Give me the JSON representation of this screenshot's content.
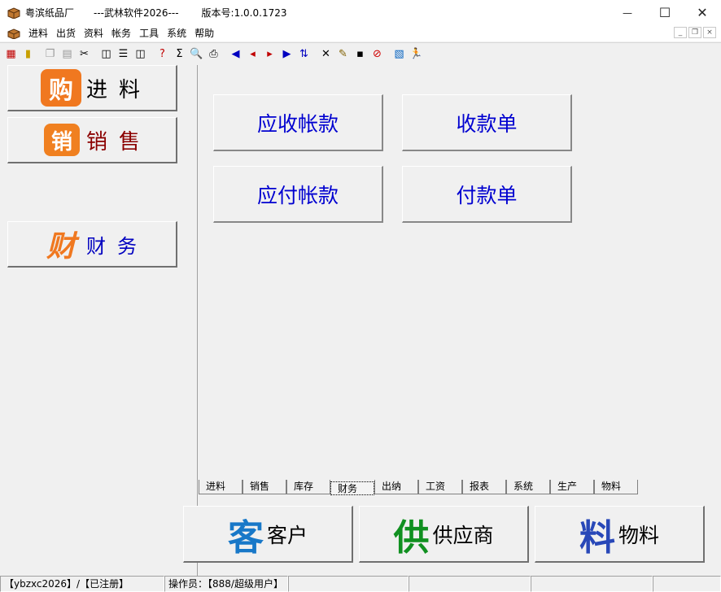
{
  "titlebar": {
    "app_name": "粤滨纸品厂",
    "product": "---武林软件2026---",
    "version": "版本号:1.0.0.1723",
    "minimize_glyph": "—",
    "maximize_glyph": "☐",
    "close_glyph": "✕"
  },
  "menu": {
    "items": [
      "进料",
      "出货",
      "资料",
      "帐务",
      "工具",
      "系统",
      "帮助"
    ],
    "mdi_minimize": "_",
    "mdi_restore": "❐",
    "mdi_close": "×"
  },
  "toolbar": {
    "buttons": [
      {
        "name": "calendar-icon",
        "glyph": "▦",
        "color": "#c00000"
      },
      {
        "name": "exit-door-icon",
        "glyph": "▮",
        "color": "#c8a000"
      },
      {
        "name": "copy-icon",
        "glyph": "❐",
        "color": "#999999"
      },
      {
        "name": "paste-icon",
        "glyph": "▤",
        "color": "#999999"
      },
      {
        "name": "cut-icon",
        "glyph": "✂",
        "color": "#000000"
      },
      {
        "name": "cascade-icon",
        "glyph": "◫",
        "color": "#000000"
      },
      {
        "name": "tile-horizontal-icon",
        "glyph": "☰",
        "color": "#000000"
      },
      {
        "name": "tile-vertical-icon",
        "glyph": "◫",
        "color": "#000000"
      },
      {
        "name": "find-icon",
        "glyph": "?",
        "color": "#c00000"
      },
      {
        "name": "sum-icon",
        "glyph": "Σ",
        "color": "#000000"
      },
      {
        "name": "preview-icon",
        "glyph": "🔍",
        "color": "#000000"
      },
      {
        "name": "print-icon",
        "glyph": "⎙",
        "color": "#000000"
      },
      {
        "name": "first-record-icon",
        "glyph": "◀",
        "color": "#0000c0"
      },
      {
        "name": "prev-record-icon",
        "glyph": "◂",
        "color": "#c00000"
      },
      {
        "name": "next-record-icon",
        "glyph": "▸",
        "color": "#c00000"
      },
      {
        "name": "last-record-icon",
        "glyph": "▶",
        "color": "#0000c0"
      },
      {
        "name": "insert-icon",
        "glyph": "⇅",
        "color": "#0000c0"
      },
      {
        "name": "delete-icon",
        "glyph": "✕",
        "color": "#000000"
      },
      {
        "name": "edit-icon",
        "glyph": "✎",
        "color": "#806000"
      },
      {
        "name": "save-icon",
        "glyph": "▪",
        "color": "#000000"
      },
      {
        "name": "cancel-icon",
        "glyph": "⊘",
        "color": "#d00000"
      },
      {
        "name": "report-icon",
        "glyph": "▧",
        "color": "#0060c0"
      },
      {
        "name": "run-exit-icon",
        "glyph": "🏃",
        "color": "#008000"
      }
    ]
  },
  "left_nav": [
    {
      "name": "nav-purchase-button",
      "logo": "购",
      "logo_bg": "#f07820",
      "label": "进料",
      "label_color": "#000000"
    },
    {
      "name": "nav-sales-button",
      "logo": "销",
      "logo_bg": "#f08020",
      "label": "销售",
      "label_color": "#8b0000"
    },
    {
      "name": "nav-finance-button",
      "logo": "财",
      "logo_bg": "#f0f0f0",
      "logo_color": "#f07820",
      "label": "财务",
      "label_color": "#0000c0"
    }
  ],
  "finance": {
    "receivable": "应收帐款",
    "receipt": "收款单",
    "payable": "应付帐款",
    "payment": "付款单"
  },
  "tabs": {
    "items": [
      "进料",
      "销售",
      "库存",
      "财务",
      "出纳",
      "工资",
      "报表",
      "系统",
      "生产",
      "物料"
    ],
    "active_index": 3
  },
  "bottom": {
    "customer": {
      "logo": "客",
      "logo_color": "#1878c8",
      "label": "客户"
    },
    "supplier": {
      "logo": "供",
      "logo_color": "#109020",
      "label": "供应商"
    },
    "material": {
      "logo": "料",
      "logo_color": "#2848b8",
      "label": "物料"
    }
  },
  "status": {
    "user_info": "【ybzxc2026】/【已注册】",
    "operator": "操作员：【888/超级用户】"
  }
}
